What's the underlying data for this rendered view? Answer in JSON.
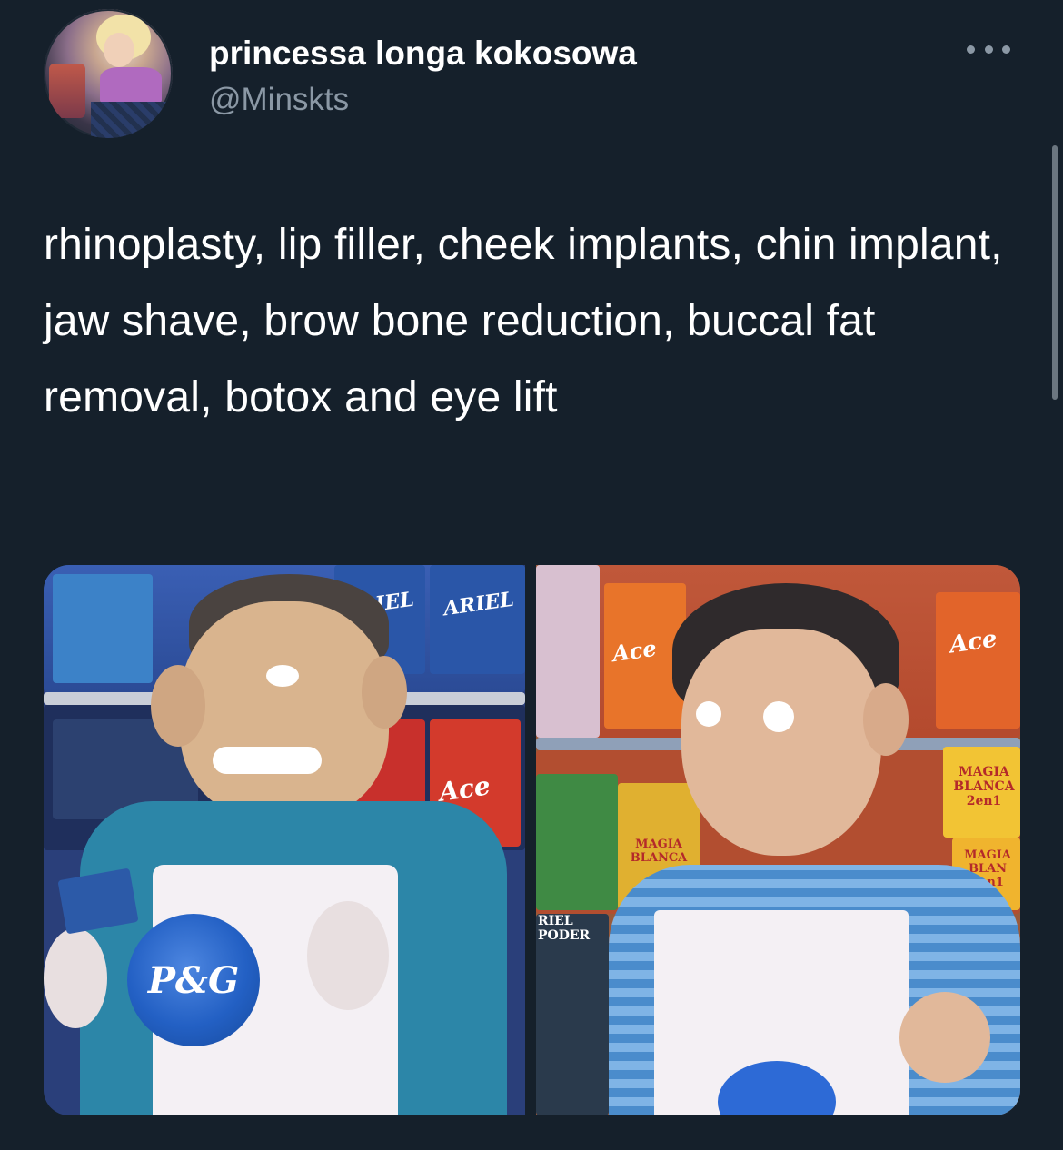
{
  "tweet": {
    "author_name": "princessa longa kokosowa",
    "author_handle": "@Minskts",
    "text": "rhinoplasty, lip filler, cheek implants, chin implant, jaw shave, brow bone reduction, buccal fat removal, botox and eye lift"
  },
  "media": {
    "left": {
      "brand_labels": [
        "ARIEL",
        "ARIEL",
        "Ace"
      ],
      "apron_logo": "P&G"
    },
    "right": {
      "brand_labels": [
        "Ace",
        "Ace",
        "MAGIA BLANCA 2en1",
        "MAGIA BLANCA",
        "MAGIA BLAN 2en1",
        "RIEL PODER"
      ]
    }
  },
  "icons": {
    "more": "more-horizontal-icon"
  },
  "colors": {
    "background": "#15202b",
    "secondary_text": "#8b98a5",
    "primary_text": "#ffffff"
  }
}
